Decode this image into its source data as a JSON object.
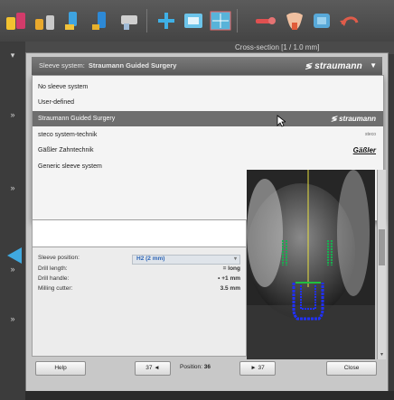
{
  "viewer": {
    "header": "Cross-section [1 / 1.0 mm]"
  },
  "toolbar": {
    "icons": [
      "implant-icon",
      "implant-pair-icon",
      "sleeve-icon",
      "sleeve-blue-icon",
      "drill-icon",
      "add-icon",
      "view-icon",
      "grid-icon",
      "wrench-icon",
      "tooth-icon",
      "sleeve-list-icon",
      "undo-icon"
    ]
  },
  "dialog": {
    "combo_label": "Sleeve system:",
    "combo_value": "Straumann Guided Surgery",
    "combo_logo": "straumann",
    "options": [
      {
        "label": "No sleeve system"
      },
      {
        "label": "User-defined"
      },
      {
        "label": "Straumann Guided Surgery",
        "logo": "straumann"
      },
      {
        "label": "steco system-technik",
        "logo": "steco"
      },
      {
        "label": "Gäßler Zahntechnik",
        "logo": "Gäßler"
      },
      {
        "label": "Generic sleeve system"
      }
    ],
    "props": {
      "sleeve_position_label": "Sleeve position:",
      "sleeve_position_value": "H2 (2 mm)",
      "drill_length_label": "Drill length:",
      "drill_length_value": "= long",
      "drill_handle_label": "Drill handle:",
      "drill_handle_value": "• +1 mm",
      "milling_cutter_label": "Milling cutter:",
      "milling_cutter_value": "3.5 mm"
    },
    "buttons": {
      "help": "Help",
      "prev": "37 ◄",
      "position_label": "Position:",
      "position_value": "36",
      "next": "► 37",
      "close": "Close"
    }
  },
  "colors": {
    "accent": "#3fa9e0",
    "selected_row": "#6e6e6e",
    "dropdown_bg": "#f4f4f4"
  }
}
